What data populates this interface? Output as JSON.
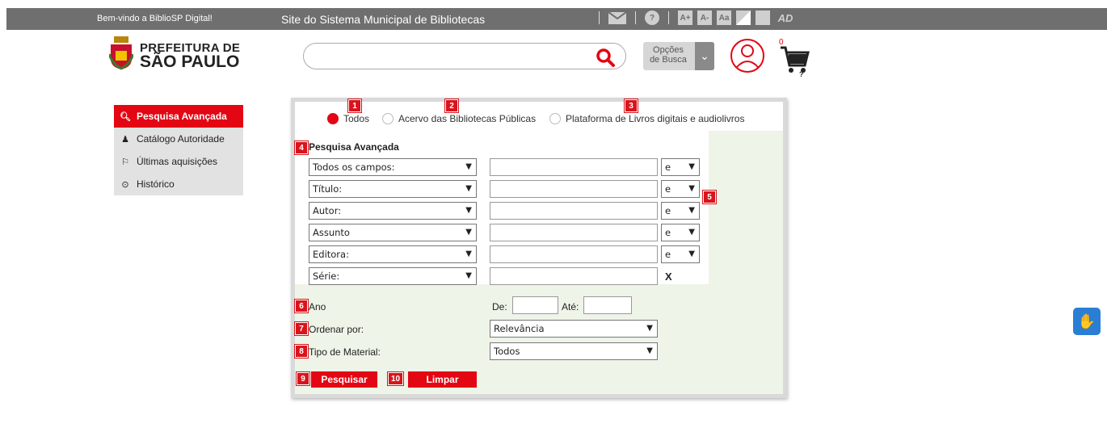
{
  "topbar": {
    "welcome": "Bem-vindo a BiblioSP Digital!",
    "site": "Site do Sistema Municipal de Bibliotecas",
    "icons": [
      "envelope-icon",
      "help-icon",
      "font-increase-icon",
      "font-decrease-icon",
      "font-reset-icon",
      "contrast-icon",
      "grayscale-icon",
      "audio-description-icon"
    ],
    "font_increase": "A+",
    "font_decrease": "A-",
    "font_reset": "Aa",
    "ad": "AD"
  },
  "logo": {
    "line1": "PREFEITURA DE",
    "line2": "SÃO PAULO"
  },
  "search": {
    "value": "",
    "placeholder": ""
  },
  "options_button": {
    "line1": "Opções",
    "line2": "de Busca"
  },
  "cart": {
    "count": "0",
    "mark": "?"
  },
  "sidebar": {
    "items": [
      {
        "label": "Pesquisa Avançada",
        "icon": "search-icon",
        "active": true
      },
      {
        "label": "Catálogo Autoridade",
        "icon": "person-icon",
        "active": false
      },
      {
        "label": "Últimas aquisições",
        "icon": "flag-icon",
        "active": false
      },
      {
        "label": "Histórico",
        "icon": "clock-icon",
        "active": false
      }
    ]
  },
  "scope": {
    "options": [
      {
        "num": "1",
        "label": "Todos",
        "selected": true
      },
      {
        "num": "2",
        "label": "Acervo das Bibliotecas Públicas",
        "selected": false
      },
      {
        "num": "3",
        "label": "Plataforma de Livros digitais e audiolivros",
        "selected": false
      }
    ]
  },
  "advanced": {
    "num": "4",
    "title": "Pesquisa Avançada",
    "operator_num": "5",
    "rows": [
      {
        "field": "Todos os campos:",
        "value": "",
        "operator": "e"
      },
      {
        "field": "Título:",
        "value": "",
        "operator": "e"
      },
      {
        "field": "Autor:",
        "value": "",
        "operator": "e"
      },
      {
        "field": "Assunto",
        "value": "",
        "operator": "e"
      },
      {
        "field": "Editora:",
        "value": "",
        "operator": "e"
      },
      {
        "field": "Série:",
        "value": "",
        "operator": "X"
      }
    ]
  },
  "year": {
    "num": "6",
    "label": "Ano",
    "from_label": "De:",
    "to_label": "Até:",
    "from": "",
    "to": ""
  },
  "sort": {
    "num": "7",
    "label": "Ordenar por:",
    "value": "Relevância"
  },
  "material": {
    "num": "8",
    "label": "Tipo de Material:",
    "value": "Todos"
  },
  "actions": {
    "search_num": "9",
    "search_label": "Pesquisar",
    "clear_num": "10",
    "clear_label": "Limpar"
  },
  "colors": {
    "accent": "#e30613",
    "topbar": "#6f6f6f",
    "panel_bg": "#eef4e8"
  }
}
